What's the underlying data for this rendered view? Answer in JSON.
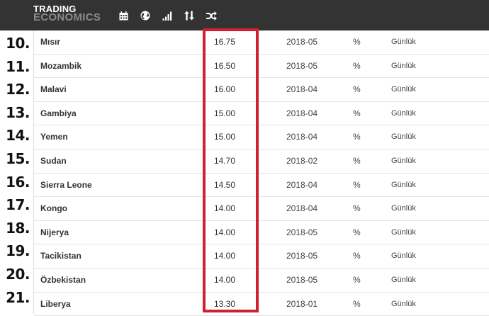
{
  "brand": {
    "line1": "TRADING",
    "line2": "ECONOMICS"
  },
  "nav_icons": [
    "calendar-icon",
    "globe-icon",
    "bar-chart-icon",
    "sort-icon",
    "shuffle-icon"
  ],
  "highlight_color": "#d3202f",
  "rows": [
    {
      "rank": "10.",
      "country": "Mısır",
      "value": "16.75",
      "date": "2018-05",
      "unit": "%",
      "frequency": "Günlük"
    },
    {
      "rank": "11.",
      "country": "Mozambik",
      "value": "16.50",
      "date": "2018-05",
      "unit": "%",
      "frequency": "Günlük"
    },
    {
      "rank": "12.",
      "country": "Malavi",
      "value": "16.00",
      "date": "2018-04",
      "unit": "%",
      "frequency": "Günlük"
    },
    {
      "rank": "13.",
      "country": "Gambiya",
      "value": "15.00",
      "date": "2018-04",
      "unit": "%",
      "frequency": "Günlük"
    },
    {
      "rank": "14.",
      "country": "Yemen",
      "value": "15.00",
      "date": "2018-04",
      "unit": "%",
      "frequency": "Günlük"
    },
    {
      "rank": "15.",
      "country": "Sudan",
      "value": "14.70",
      "date": "2018-02",
      "unit": "%",
      "frequency": "Günlük"
    },
    {
      "rank": "16.",
      "country": "Sierra Leone",
      "value": "14.50",
      "date": "2018-04",
      "unit": "%",
      "frequency": "Günlük"
    },
    {
      "rank": "17.",
      "country": "Kongo",
      "value": "14.00",
      "date": "2018-04",
      "unit": "%",
      "frequency": "Günlük"
    },
    {
      "rank": "18.",
      "country": "Nijerya",
      "value": "14.00",
      "date": "2018-05",
      "unit": "%",
      "frequency": "Günlük"
    },
    {
      "rank": "19.",
      "country": "Tacikistan",
      "value": "14.00",
      "date": "2018-05",
      "unit": "%",
      "frequency": "Günlük"
    },
    {
      "rank": "20.",
      "country": "Özbekistan",
      "value": "14.00",
      "date": "2018-05",
      "unit": "%",
      "frequency": "Günlük"
    },
    {
      "rank": "21.",
      "country": "Liberya",
      "value": "13.30",
      "date": "2018-01",
      "unit": "%",
      "frequency": "Günlük"
    }
  ]
}
